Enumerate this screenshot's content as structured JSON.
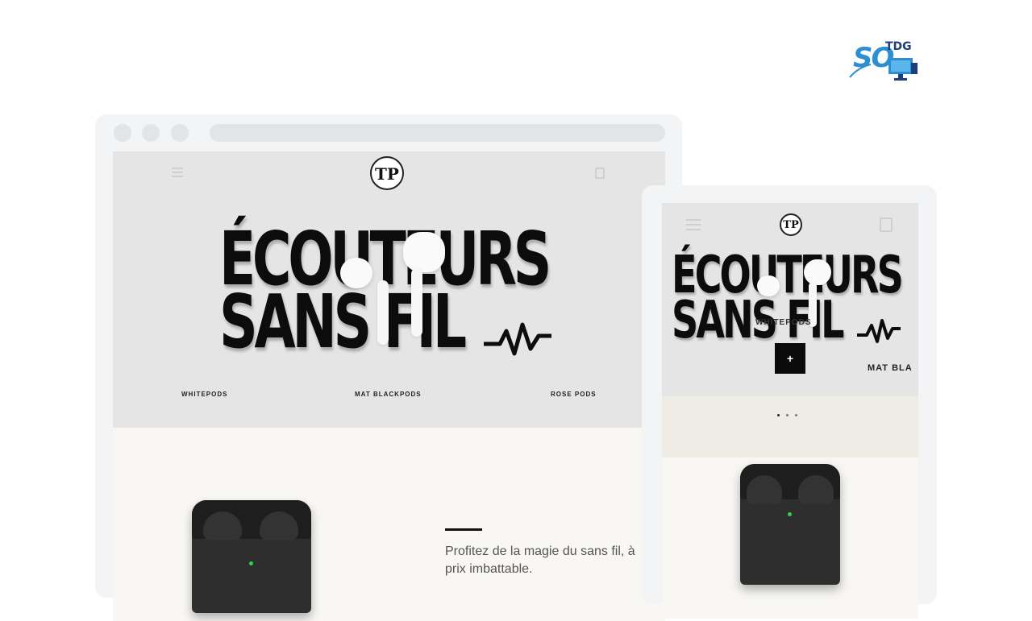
{
  "brand": {
    "logo_text_left": "SO",
    "logo_text_right": "TDG",
    "colors": {
      "blue": "#2b8fd1",
      "navy": "#1d3f7a"
    }
  },
  "desktop": {
    "logo": "TP",
    "headline_line1": "ÉCOUTEURS",
    "headline_line2": "SANS FIL",
    "tabs": [
      "WHITEPODS",
      "MAT BLACKPODS",
      "ROSE PODS"
    ],
    "tagline": "Profitez de la magie du sans fil, à prix imbattable."
  },
  "mobile": {
    "logo": "TP",
    "headline_line1": "ÉCOUTEURS",
    "headline_line2": "SANS FIL",
    "product_label": "WHITEPODS",
    "add_symbol": "+",
    "next_label": "MAT BLA"
  },
  "icons": [
    "menu-icon",
    "bag-icon",
    "pulse-wave-icon",
    "plus-icon"
  ]
}
